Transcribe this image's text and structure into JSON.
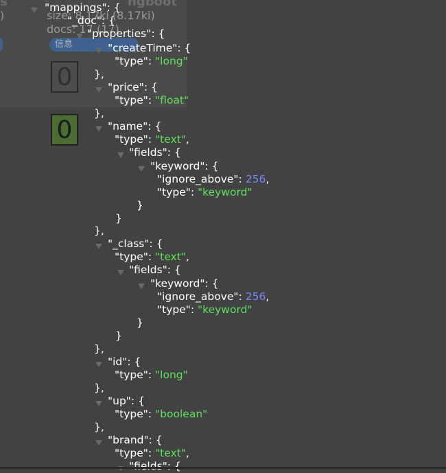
{
  "background": {
    "title_fragment_left": "s",
    "title_fragment_right": "ngboot",
    "paren_fragment": ")",
    "size_text": "size: 8.17ki (8.17ki)",
    "docs_text": "docs: 17 (17)",
    "info_button": "信息",
    "shard_gray": "0",
    "shard_green": "0"
  },
  "json": {
    "mappings": "\"mappings\"",
    "doc": "\"_doc\"",
    "properties": "\"properties\"",
    "fields": [
      {
        "key": "\"createTime\"",
        "type": "\"long\""
      },
      {
        "key": "\"price\"",
        "type": "\"float\""
      },
      {
        "key": "\"name\"",
        "type": "\"text\"",
        "sub": {
          "fields": "\"fields\"",
          "keyword": "\"keyword\"",
          "ignore_above_key": "\"ignore_above\"",
          "ignore_above": "256",
          "sub_type": "\"keyword\""
        }
      },
      {
        "key": "\"_class\"",
        "type": "\"text\"",
        "sub": {
          "fields": "\"fields\"",
          "keyword": "\"keyword\"",
          "ignore_above_key": "\"ignore_above\"",
          "ignore_above": "256",
          "sub_type": "\"keyword\""
        }
      },
      {
        "key": "\"id\"",
        "type": "\"long\""
      },
      {
        "key": "\"up\"",
        "type": "\"boolean\""
      },
      {
        "key": "\"brand\"",
        "type": "\"text\"",
        "sub": {
          "fields": "\"fields\""
        }
      }
    ],
    "type_key": "\"type\""
  },
  "colors": {
    "background": "#424242",
    "string": "#5fe05f",
    "number": "#7b86ff",
    "key": "#ffffff"
  }
}
